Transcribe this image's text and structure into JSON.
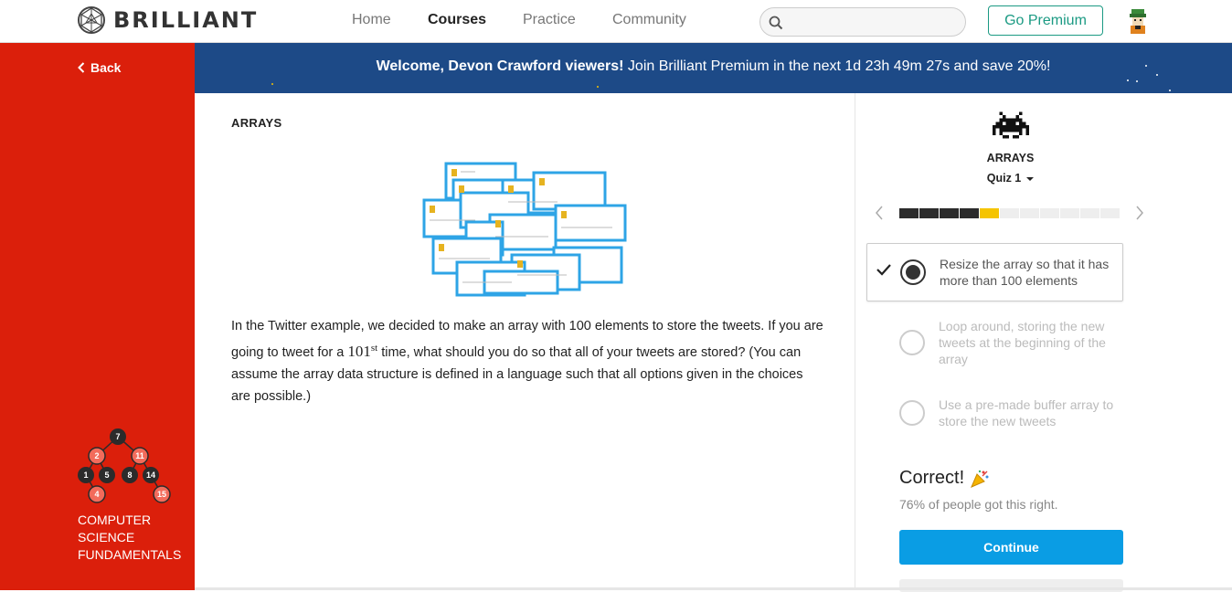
{
  "nav": {
    "brand": "BRILLIANT",
    "links": [
      "Home",
      "Courses",
      "Practice",
      "Community"
    ],
    "active": "Courses",
    "search_placeholder": "",
    "premium_label": "Go Premium"
  },
  "sidebar": {
    "back_label": "Back",
    "course_title_lines": [
      "COMPUTER",
      "SCIENCE",
      "FUNDAMENTALS"
    ],
    "tree_nodes": [
      "7",
      "2",
      "11",
      "1",
      "5",
      "8",
      "14",
      "4",
      "15"
    ]
  },
  "banner": {
    "bold": "Welcome, Devon Crawford viewers!",
    "rest": " Join Brilliant Premium in the next 1d 23h 49m 27s and save 20%!"
  },
  "problem": {
    "heading": "ARRAYS",
    "text_before": "In the Twitter example, we decided to make an array with 100 elements to store the tweets. If you are going to tweet for a ",
    "math_num": "101",
    "math_sup": "st",
    "text_after": " time, what should you do so that all of your tweets are stored? (You can assume the array data structure is defined in a language such that all options given in the choices are possible.)"
  },
  "quiz": {
    "topic": "ARRAYS",
    "quiz_label": "Quiz 1",
    "progress_total": 11,
    "progress_done": 4,
    "progress_current_index": 4,
    "options": [
      {
        "text": "Resize the array so that it has more than 100 elements",
        "selected": true
      },
      {
        "text": "Loop around, storing the new tweets at the beginning of the array",
        "selected": false
      },
      {
        "text": "Use a pre-made buffer array to store the new tweets",
        "selected": false
      }
    ],
    "result_title": "Correct!",
    "result_stat": "76% of people got this right.",
    "continue_label": "Continue"
  },
  "colors": {
    "sidebar_red": "#db1f0b",
    "banner_blue": "#1d4a87",
    "premium_green": "#1b9a83",
    "continue_blue": "#0a9de4",
    "progress_current": "#f5c400"
  }
}
